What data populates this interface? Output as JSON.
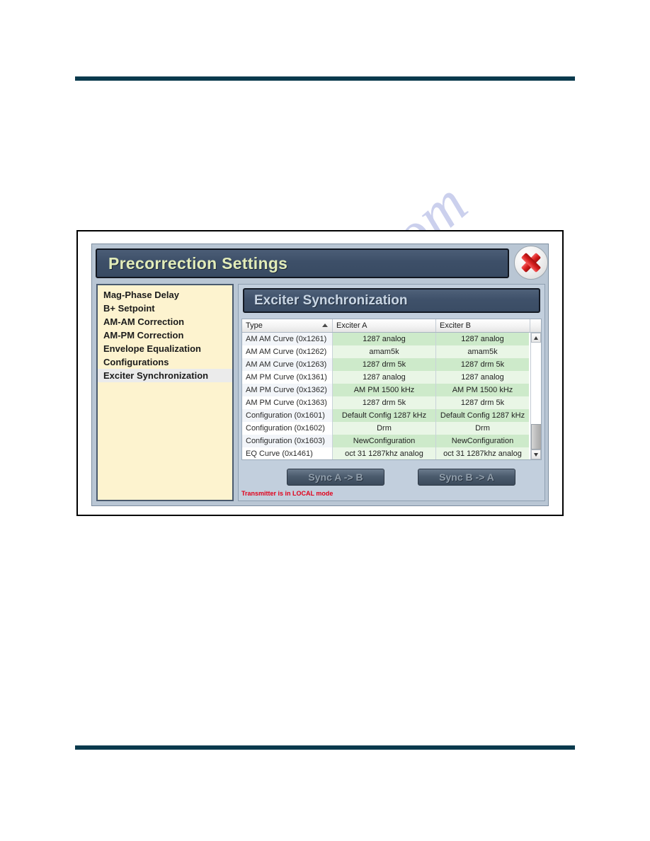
{
  "page": {
    "watermark": "manualshive.com",
    "rule_color": "#0a3a4d"
  },
  "dialog": {
    "title": "Precorrection Settings",
    "close_icon": "close-icon",
    "sidebar": {
      "items": [
        {
          "label": "Mag-Phase Delay",
          "selected": false
        },
        {
          "label": "B+ Setpoint",
          "selected": false
        },
        {
          "label": "AM-AM Correction",
          "selected": false
        },
        {
          "label": "AM-PM Correction",
          "selected": false
        },
        {
          "label": "Envelope Equalization",
          "selected": false
        },
        {
          "label": "Configurations",
          "selected": false
        },
        {
          "label": "Exciter Synchronization",
          "selected": true
        }
      ]
    },
    "panel": {
      "header": "Exciter Synchronization",
      "table": {
        "columns": [
          "Type",
          "Exciter A",
          "Exciter B"
        ],
        "sort_column": "Type",
        "sort_direction": "ascending",
        "rows": [
          {
            "type": "AM AM Curve (0x1261)",
            "a": "1287 analog",
            "b": "1287 analog"
          },
          {
            "type": "AM AM Curve (0x1262)",
            "a": "amam5k",
            "b": "amam5k"
          },
          {
            "type": "AM AM Curve (0x1263)",
            "a": "1287 drm 5k",
            "b": "1287 drm 5k"
          },
          {
            "type": "AM PM Curve (0x1361)",
            "a": "1287 analog",
            "b": "1287 analog"
          },
          {
            "type": "AM PM Curve (0x1362)",
            "a": "AM PM 1500 kHz",
            "b": "AM PM 1500 kHz"
          },
          {
            "type": "AM PM Curve (0x1363)",
            "a": "1287 drm 5k",
            "b": "1287 drm 5k"
          },
          {
            "type": "Configuration (0x1601)",
            "a": "Default Config 1287 kHz",
            "b": "Default Config 1287 kHz"
          },
          {
            "type": "Configuration (0x1602)",
            "a": "Drm",
            "b": "Drm"
          },
          {
            "type": "Configuration (0x1603)",
            "a": "NewConfiguration",
            "b": "NewConfiguration"
          },
          {
            "type": "EQ Curve (0x1461)",
            "a": "oct 31 1287khz analog",
            "b": "oct 31 1287khz analog"
          }
        ]
      },
      "buttons": {
        "sync_a_to_b": "Sync A -> B",
        "sync_b_to_a": "Sync B -> A"
      },
      "status": "Transmitter is in LOCAL mode"
    }
  }
}
